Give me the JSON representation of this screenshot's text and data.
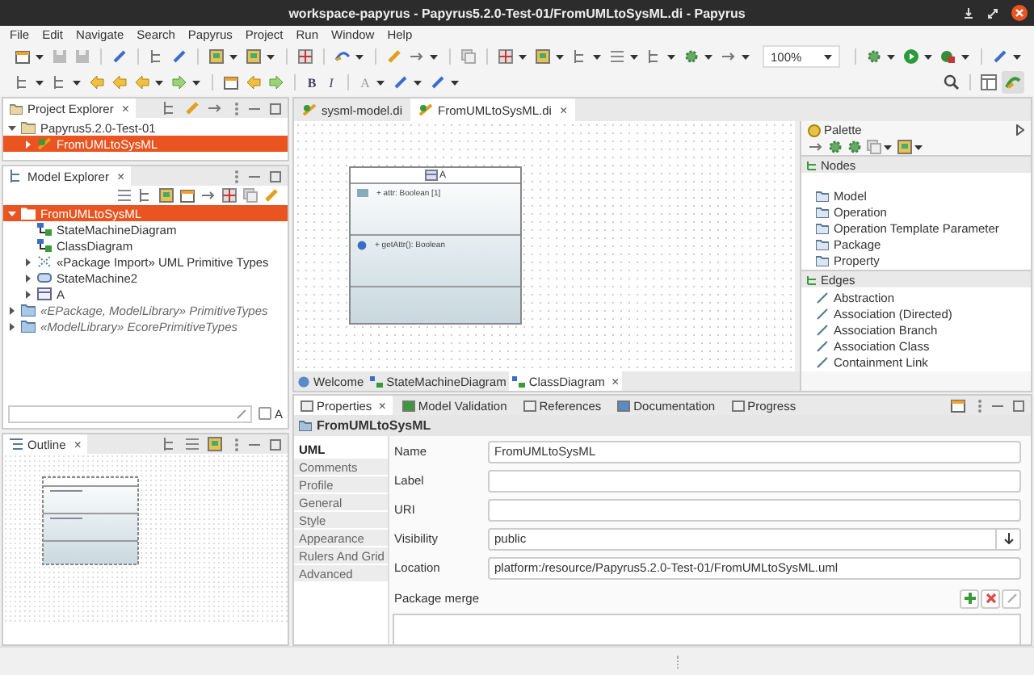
{
  "window": {
    "title": "workspace-papyrus - Papyrus5.2.0-Test-01/FromUMLtoSysML.di - Papyrus"
  },
  "menu": [
    "File",
    "Edit",
    "Navigate",
    "Search",
    "Papyrus",
    "Project",
    "Run",
    "Window",
    "Help"
  ],
  "toolbar": {
    "zoom": "100%",
    "bold": "B",
    "italic": "I",
    "font_color": "A"
  },
  "project_explorer": {
    "title": "Project Explorer",
    "close": "×",
    "tree": [
      {
        "label": "Papyrus5.2.0-Test-01",
        "kind": "project",
        "expanded": true,
        "selected": false,
        "children": [
          {
            "label": "FromUMLtoSysML",
            "kind": "model",
            "expanded": false,
            "selected": true
          }
        ]
      }
    ]
  },
  "model_explorer": {
    "title": "Model Explorer",
    "close": "×",
    "tree": [
      {
        "label": "FromUMLtoSysML",
        "kind": "package",
        "expanded": true,
        "selected": true,
        "children": [
          {
            "label": "StateMachineDiagram",
            "kind": "diagram",
            "selected": false
          },
          {
            "label": "ClassDiagram",
            "kind": "diagram",
            "selected": false
          },
          {
            "label": "«Package Import» UML Primitive Types",
            "kind": "import",
            "expanded": false,
            "selected": false
          },
          {
            "label": "StateMachine2",
            "kind": "statemachine",
            "expanded": false,
            "selected": false
          },
          {
            "label": "A",
            "kind": "class",
            "expanded": false,
            "selected": false
          }
        ]
      },
      {
        "label": "«EPackage, ModelLibrary» PrimitiveTypes",
        "kind": "library",
        "expanded": false,
        "selected": false
      },
      {
        "label": "«ModelLibrary» EcorePrimitiveTypes",
        "kind": "library",
        "expanded": false,
        "selected": false
      }
    ],
    "filter_checkbox": {
      "label": "A",
      "checked": false
    }
  },
  "editor": {
    "tabs": [
      {
        "label": "sysml-model.di",
        "selected": false
      },
      {
        "label": "FromUMLtoSysML.di",
        "selected": true,
        "close": "×"
      }
    ],
    "class": {
      "name": "A",
      "attribute": "+ attr: Boolean [1]",
      "operation": "+ getAttr(): Boolean"
    },
    "diagram_tabs": [
      {
        "label": "Welcome",
        "selected": false
      },
      {
        "label": "StateMachineDiagram",
        "selected": false
      },
      {
        "label": "ClassDiagram",
        "selected": true,
        "close": "×"
      }
    ]
  },
  "palette": {
    "title": "Palette",
    "drawers": [
      {
        "title": "Nodes",
        "kind": "nodes",
        "items": [
          "Model",
          "Operation",
          "Operation Template Parameter",
          "Package",
          "Property"
        ]
      },
      {
        "title": "Edges",
        "kind": "edges",
        "items": [
          "Abstraction",
          "Association (Directed)",
          "Association Branch",
          "Association Class",
          "Containment Link"
        ]
      }
    ]
  },
  "outline": {
    "title": "Outline",
    "close": "×"
  },
  "properties": {
    "tabs": [
      {
        "label": "Properties",
        "selected": true,
        "close": "×"
      },
      {
        "label": "Model Validation",
        "selected": false
      },
      {
        "label": "References",
        "selected": false
      },
      {
        "label": "Documentation",
        "selected": false
      },
      {
        "label": "Progress",
        "selected": false
      }
    ],
    "header": "FromUMLtoSysML",
    "side_tabs": [
      {
        "label": "UML",
        "selected": true
      },
      {
        "label": "Comments",
        "selected": false
      },
      {
        "label": "Profile",
        "selected": false
      },
      {
        "label": "General",
        "selected": false
      },
      {
        "label": "Style",
        "selected": false
      },
      {
        "label": "Appearance",
        "selected": false
      },
      {
        "label": "Rulers And Grid",
        "selected": false
      },
      {
        "label": "Advanced",
        "selected": false
      }
    ],
    "fields": [
      {
        "label": "Name",
        "kind": "text",
        "value": "FromUMLtoSysML"
      },
      {
        "label": "Label",
        "kind": "text"
      },
      {
        "label": "URI",
        "kind": "text"
      },
      {
        "label": "Visibility",
        "kind": "combo",
        "value": "public"
      },
      {
        "label": "Location",
        "kind": "text",
        "value": "platform:/resource/Papyrus5.2.0-Test-01/FromUMLtoSysML.uml"
      },
      {
        "label": "Package merge",
        "kind": "list"
      }
    ]
  }
}
